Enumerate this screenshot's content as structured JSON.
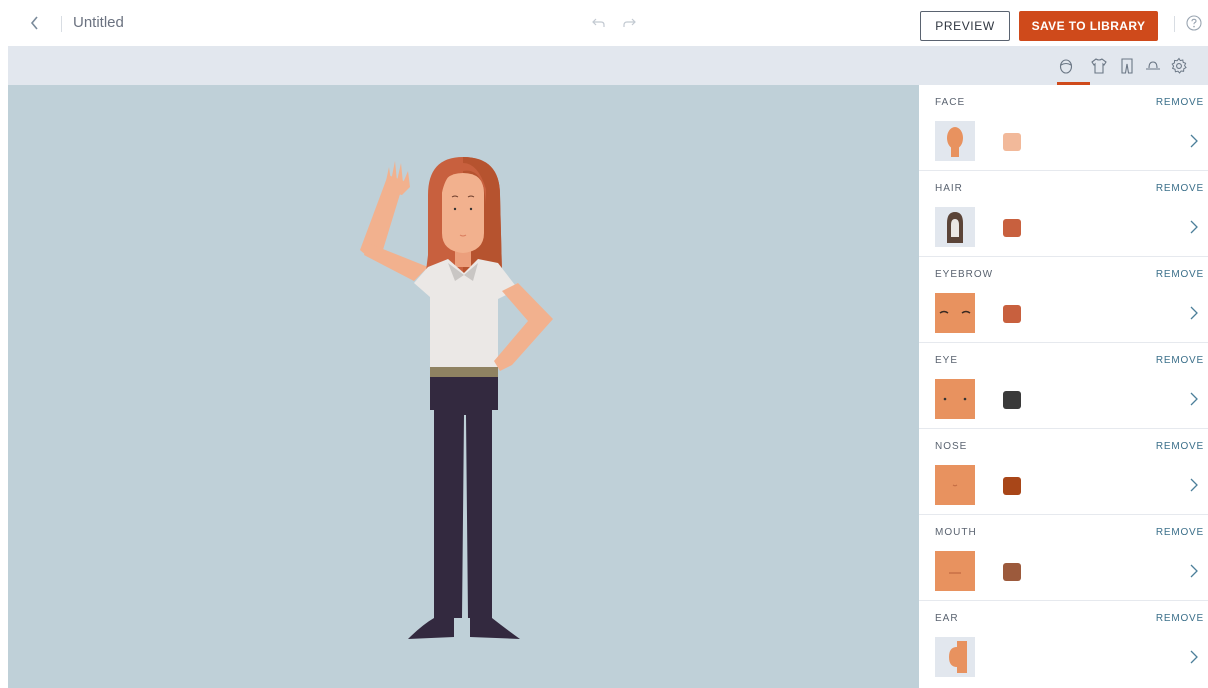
{
  "header": {
    "title": "Untitled",
    "preview_label": "PREVIEW",
    "save_label": "SAVE TO LIBRARY"
  },
  "icons": {
    "back": "chevron-left-icon",
    "undo": "undo-icon",
    "redo": "redo-icon",
    "help": "help-circle-icon"
  },
  "category_tabs": [
    {
      "icon": "face-icon",
      "active": true
    },
    {
      "icon": "shirt-icon",
      "active": false
    },
    {
      "icon": "pants-icon",
      "active": false
    },
    {
      "icon": "hat-icon",
      "active": false
    },
    {
      "icon": "settings-icon",
      "active": false
    }
  ],
  "colors": {
    "accent": "#cf4a1b",
    "canvas_bg": "#bfd0d8",
    "toolbar_bg": "#e2e7ee",
    "link": "#3b6f8a"
  },
  "sections": [
    {
      "label": "FACE",
      "remove_label": "REMOVE",
      "swatch": "#f2b99a"
    },
    {
      "label": "HAIR",
      "remove_label": "REMOVE",
      "swatch": "#c8603e"
    },
    {
      "label": "EYEBROW",
      "remove_label": "REMOVE",
      "swatch": "#c8603e"
    },
    {
      "label": "EYE",
      "remove_label": "REMOVE",
      "swatch": "#3a3a3a"
    },
    {
      "label": "NOSE",
      "remove_label": "REMOVE",
      "swatch": "#a84618"
    },
    {
      "label": "MOUTH",
      "remove_label": "REMOVE",
      "swatch": "#9c5a3c"
    },
    {
      "label": "EAR",
      "remove_label": "REMOVE",
      "swatch": null
    }
  ]
}
